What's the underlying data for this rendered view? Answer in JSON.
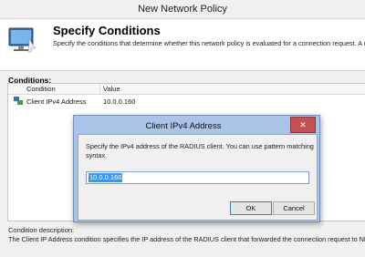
{
  "window": {
    "title": "New Network Policy"
  },
  "header": {
    "title": "Specify Conditions",
    "description": "Specify the conditions that determine whether this network policy is evaluated for a connection request. A m of one condition is required.",
    "icon": "computer-monitor-icon"
  },
  "conditions": {
    "label": "Conditions:",
    "columns": [
      "Condition",
      "Value"
    ],
    "rows": [
      {
        "condition": "Client IPv4 Address",
        "value": "10.0.0.160",
        "icon": "network-condition-icon"
      }
    ]
  },
  "condition_description": {
    "label": "Condition description:",
    "text": "The Client IP Address condition specifies the IP address of the RADIUS client that forwarded the connection request to NPS."
  },
  "dialog": {
    "title": "Client IPv4 Address",
    "close_label": "✕",
    "prompt": "Specify the IPv4 address of the RADIUS client. You can use pattern matching syntax.",
    "input_value": "10.0.0.160",
    "ok_label": "OK",
    "cancel_label": "Cancel"
  },
  "colors": {
    "dialog_frame": "#a9c4e6",
    "close_button": "#c75050",
    "selection": "#3399ff"
  }
}
